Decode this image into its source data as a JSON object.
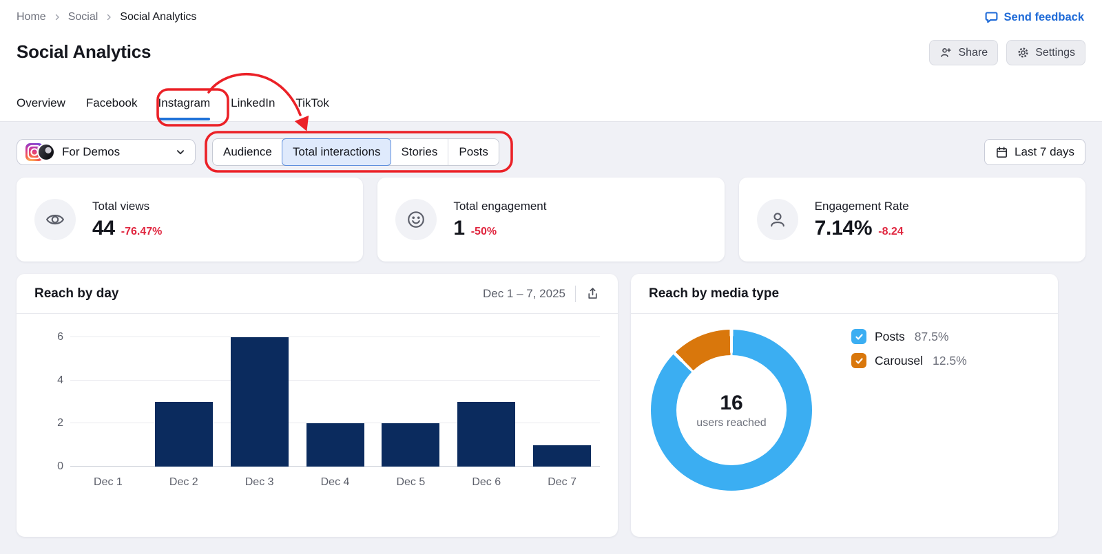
{
  "breadcrumb": {
    "items": [
      "Home",
      "Social",
      "Social Analytics"
    ]
  },
  "feedback": {
    "label": "Send feedback",
    "icon": "speech-bubble-icon"
  },
  "header": {
    "title": "Social Analytics",
    "share_label": "Share",
    "settings_label": "Settings"
  },
  "tabs": {
    "items": [
      {
        "label": "Overview",
        "active": false
      },
      {
        "label": "Facebook",
        "active": false
      },
      {
        "label": "Instagram",
        "active": true
      },
      {
        "label": "LinkedIn",
        "active": false
      },
      {
        "label": "TikTok",
        "active": false
      }
    ],
    "active_underline_color": "#1f72d8"
  },
  "profile_selector": {
    "label": "For Demos",
    "icons": [
      "instagram-logo-icon",
      "avatar"
    ]
  },
  "segmented_control": {
    "items": [
      {
        "label": "Audience",
        "selected": false
      },
      {
        "label": "Total interactions",
        "selected": true
      },
      {
        "label": "Stories",
        "selected": false
      },
      {
        "label": "Posts",
        "selected": false
      }
    ],
    "selected_bg": "#dfeafc",
    "selected_border": "#5e8fdd"
  },
  "date_range_button": {
    "label": "Last 7 days",
    "icon": "calendar-icon"
  },
  "metric_cards": [
    {
      "icon": "eye-icon",
      "label": "Total views",
      "value": "44",
      "change": "-76.47%"
    },
    {
      "icon": "smiley-icon",
      "label": "Total engagement",
      "value": "1",
      "change": "-50%"
    },
    {
      "icon": "person-icon",
      "label": "Engagement Rate",
      "value": "7.14%",
      "change": "-8.24"
    }
  ],
  "negative_color": "#e0263f",
  "reach_by_day": {
    "title": "Reach by day",
    "date_range": "Dec 1 – 7, 2025",
    "export_icon": "export-icon"
  },
  "reach_by_media": {
    "title": "Reach by media type",
    "center_value": "16",
    "center_label": "users reached",
    "legend": [
      {
        "label": "Posts",
        "value": "87.5%",
        "color": "#3baef2"
      },
      {
        "label": "Carousel",
        "value": "12.5%",
        "color": "#d9770c"
      }
    ]
  },
  "chart_data": [
    {
      "type": "bar",
      "title": "Reach by day",
      "categories": [
        "Dec 1",
        "Dec 2",
        "Dec 3",
        "Dec 4",
        "Dec 5",
        "Dec 6",
        "Dec 7"
      ],
      "values": [
        0,
        3,
        6,
        2,
        2,
        3,
        1
      ],
      "xlabel": "",
      "ylabel": "",
      "ylim": [
        0,
        6
      ],
      "yticks": [
        0,
        2,
        4,
        6
      ],
      "grid": true,
      "bar_color": "#0b2b5e"
    },
    {
      "type": "pie",
      "title": "Reach by media type",
      "labels": [
        "Posts",
        "Carousel"
      ],
      "values": [
        87.5,
        12.5
      ],
      "colors": [
        "#3baef2",
        "#d9770c"
      ],
      "center_value": "16",
      "center_label": "users reached",
      "legend_position": "right"
    }
  ],
  "annotations": {
    "color": "#eb2127"
  }
}
